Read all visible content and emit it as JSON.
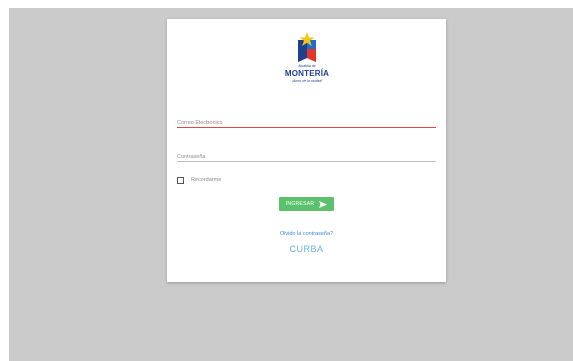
{
  "logo": {
    "subtitle": "Alcaldía de",
    "name": "MONTERÍA",
    "tagline": "¡Amor de la ciudad!"
  },
  "form": {
    "email_placeholder": "Correo Electronico",
    "password_placeholder": "Contraseña",
    "remember_label": "Recordarme",
    "login_label": "INGRESAR",
    "forgot_label": "Olvido la contraseña?"
  },
  "brand": "CURBA",
  "colors": {
    "background": "#cbcbcb",
    "card": "#ffffff",
    "button": "#5cc16d",
    "link": "#3f88d8",
    "brand": "#6aaee8",
    "error_underline": "#e04848"
  },
  "icons": {
    "login": "send-icon",
    "logo": "monteria-flag-star-icon"
  }
}
